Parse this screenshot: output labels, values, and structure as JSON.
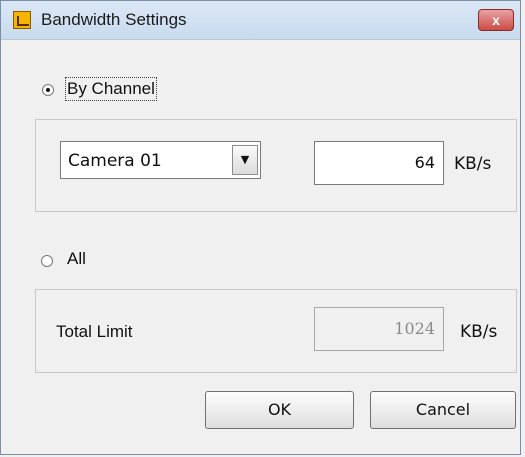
{
  "window": {
    "title": "Bandwidth Settings",
    "close_glyph": "x",
    "icon": "app-icon"
  },
  "by_channel": {
    "label": "By Channel",
    "checked": true,
    "channel": "Camera 01",
    "bandwidth": "64",
    "unit": "KB/s"
  },
  "all": {
    "label": "All",
    "checked": false,
    "total_label": "Total Limit",
    "total_value": "1024",
    "unit": "KB/s"
  },
  "buttons": {
    "ok": "OK",
    "cancel": "Cancel"
  }
}
